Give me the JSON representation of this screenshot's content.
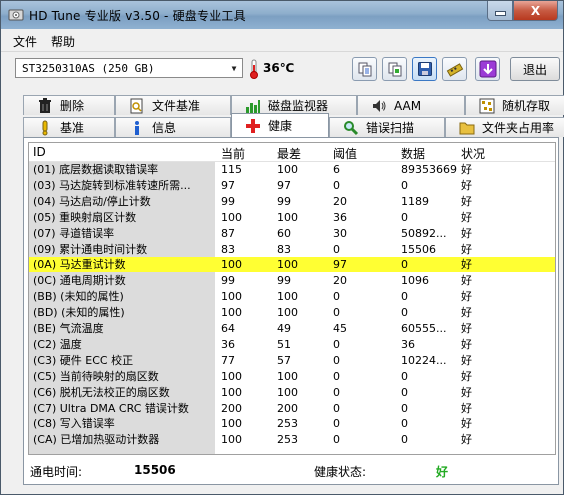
{
  "window": {
    "title": "HD Tune 专业版 v3.50 - 硬盘专业工具",
    "close_glyph": "X"
  },
  "menu": {
    "file": "文件",
    "help": "帮助"
  },
  "toolbar": {
    "drive": "ST3250310AS (250 GB)",
    "temperature": "36℃",
    "exit_label": "退出",
    "buttons": [
      "copy-text-icon",
      "copy-screenshot-icon",
      "save-icon",
      "options-icon",
      "download-icon"
    ]
  },
  "tabs_top": [
    {
      "label": "删除",
      "icon": "trash-icon"
    },
    {
      "label": "文件基准",
      "icon": "file-benchmark-icon"
    },
    {
      "label": "磁盘监视器",
      "icon": "disk-monitor-icon"
    },
    {
      "label": "AAM",
      "icon": "speaker-icon"
    },
    {
      "label": "随机存取",
      "icon": "random-access-icon"
    }
  ],
  "tabs_bottom": [
    {
      "label": "基准",
      "icon": "benchmark-icon"
    },
    {
      "label": "信息",
      "icon": "info-icon"
    },
    {
      "label": "健康",
      "icon": "health-cross-icon"
    },
    {
      "label": "错误扫描",
      "icon": "magnifier-icon"
    },
    {
      "label": "文件夹占用率",
      "icon": "folder-icon"
    }
  ],
  "active_tab": "健康",
  "columns": [
    "ID",
    "当前",
    "最差",
    "阈值",
    "数据",
    "状况"
  ],
  "rows": [
    {
      "id": "(01) 底层数据读取错误率",
      "current": "115",
      "worst": "100",
      "threshold": "6",
      "data": "89353669",
      "status": "好"
    },
    {
      "id": "(03) 马达旋转到标准转速所需...",
      "current": "97",
      "worst": "97",
      "threshold": "0",
      "data": "0",
      "status": "好"
    },
    {
      "id": "(04) 马达启动/停止计数",
      "current": "99",
      "worst": "99",
      "threshold": "20",
      "data": "1189",
      "status": "好"
    },
    {
      "id": "(05) 重映射扇区计数",
      "current": "100",
      "worst": "100",
      "threshold": "36",
      "data": "0",
      "status": "好"
    },
    {
      "id": "(07) 寻道错误率",
      "current": "87",
      "worst": "60",
      "threshold": "30",
      "data": "50892...",
      "status": "好"
    },
    {
      "id": "(09) 累计通电时间计数",
      "current": "83",
      "worst": "83",
      "threshold": "0",
      "data": "15506",
      "status": "好"
    },
    {
      "id": "(0A) 马达重试计数",
      "current": "100",
      "worst": "100",
      "threshold": "97",
      "data": "0",
      "status": "好",
      "highlight": true
    },
    {
      "id": "(0C) 通电周期计数",
      "current": "99",
      "worst": "99",
      "threshold": "20",
      "data": "1096",
      "status": "好"
    },
    {
      "id": "(BB) (未知的属性)",
      "current": "100",
      "worst": "100",
      "threshold": "0",
      "data": "0",
      "status": "好"
    },
    {
      "id": "(BD) (未知的属性)",
      "current": "100",
      "worst": "100",
      "threshold": "0",
      "data": "0",
      "status": "好"
    },
    {
      "id": "(BE) 气流温度",
      "current": "64",
      "worst": "49",
      "threshold": "45",
      "data": "60555...",
      "status": "好"
    },
    {
      "id": "(C2) 温度",
      "current": "36",
      "worst": "51",
      "threshold": "0",
      "data": "36",
      "status": "好"
    },
    {
      "id": "(C3) 硬件 ECC 校正",
      "current": "77",
      "worst": "57",
      "threshold": "0",
      "data": "10224...",
      "status": "好"
    },
    {
      "id": "(C5) 当前待映射的扇区数",
      "current": "100",
      "worst": "100",
      "threshold": "0",
      "data": "0",
      "status": "好"
    },
    {
      "id": "(C6) 脱机无法校正的扇区数",
      "current": "100",
      "worst": "100",
      "threshold": "0",
      "data": "0",
      "status": "好"
    },
    {
      "id": "(C7) Ultra DMA CRC 错误计数",
      "current": "200",
      "worst": "200",
      "threshold": "0",
      "data": "0",
      "status": "好"
    },
    {
      "id": "(C8) 写入错误率",
      "current": "100",
      "worst": "253",
      "threshold": "0",
      "data": "0",
      "status": "好"
    },
    {
      "id": "(CA) 已增加热驱动计数器",
      "current": "100",
      "worst": "253",
      "threshold": "0",
      "data": "0",
      "status": "好"
    }
  ],
  "status_bar": {
    "power_on_label": "通电时间:",
    "power_on_value": "15506",
    "health_label": "健康状态:",
    "health_value": "好"
  },
  "colors": {
    "highlight": "#ffff33",
    "health_ok": "#22aa22",
    "cross_red": "#e02020"
  }
}
